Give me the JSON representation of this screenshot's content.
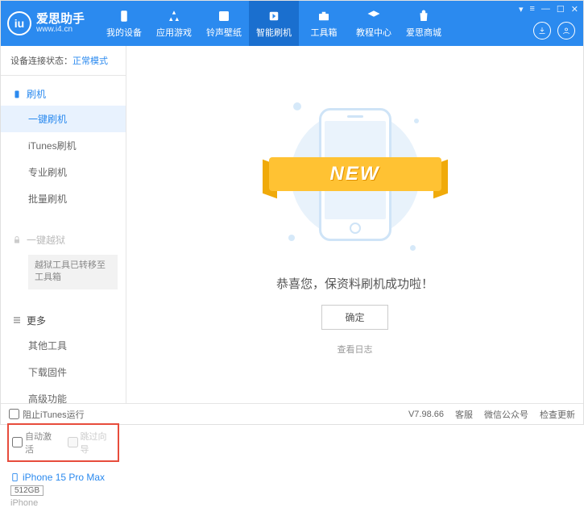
{
  "header": {
    "logo_title": "爱思助手",
    "logo_url": "www.i4.cn",
    "nav": [
      {
        "label": "我的设备"
      },
      {
        "label": "应用游戏"
      },
      {
        "label": "铃声壁纸"
      },
      {
        "label": "智能刷机"
      },
      {
        "label": "工具箱"
      },
      {
        "label": "教程中心"
      },
      {
        "label": "爱思商城"
      }
    ]
  },
  "sidebar": {
    "status_label": "设备连接状态：",
    "status_value": "正常模式",
    "flash_header": "刷机",
    "items_flash": [
      {
        "label": "一键刷机"
      },
      {
        "label": "iTunes刷机"
      },
      {
        "label": "专业刷机"
      },
      {
        "label": "批量刷机"
      }
    ],
    "jailbreak_header": "一键越狱",
    "jailbreak_note": "越狱工具已转移至工具箱",
    "more_header": "更多",
    "items_more": [
      {
        "label": "其他工具"
      },
      {
        "label": "下载固件"
      },
      {
        "label": "高级功能"
      }
    ],
    "chk_auto_activate": "自动激活",
    "chk_skip_guide": "跳过向导",
    "device": {
      "name": "iPhone 15 Pro Max",
      "storage": "512GB",
      "type": "iPhone"
    }
  },
  "main": {
    "banner": "NEW",
    "success": "恭喜您，保资料刷机成功啦！",
    "ok": "确定",
    "log_link": "查看日志"
  },
  "footer": {
    "stop_itunes": "阻止iTunes运行",
    "version": "V7.98.66",
    "support": "客服",
    "wechat": "微信公众号",
    "update": "检查更新"
  }
}
